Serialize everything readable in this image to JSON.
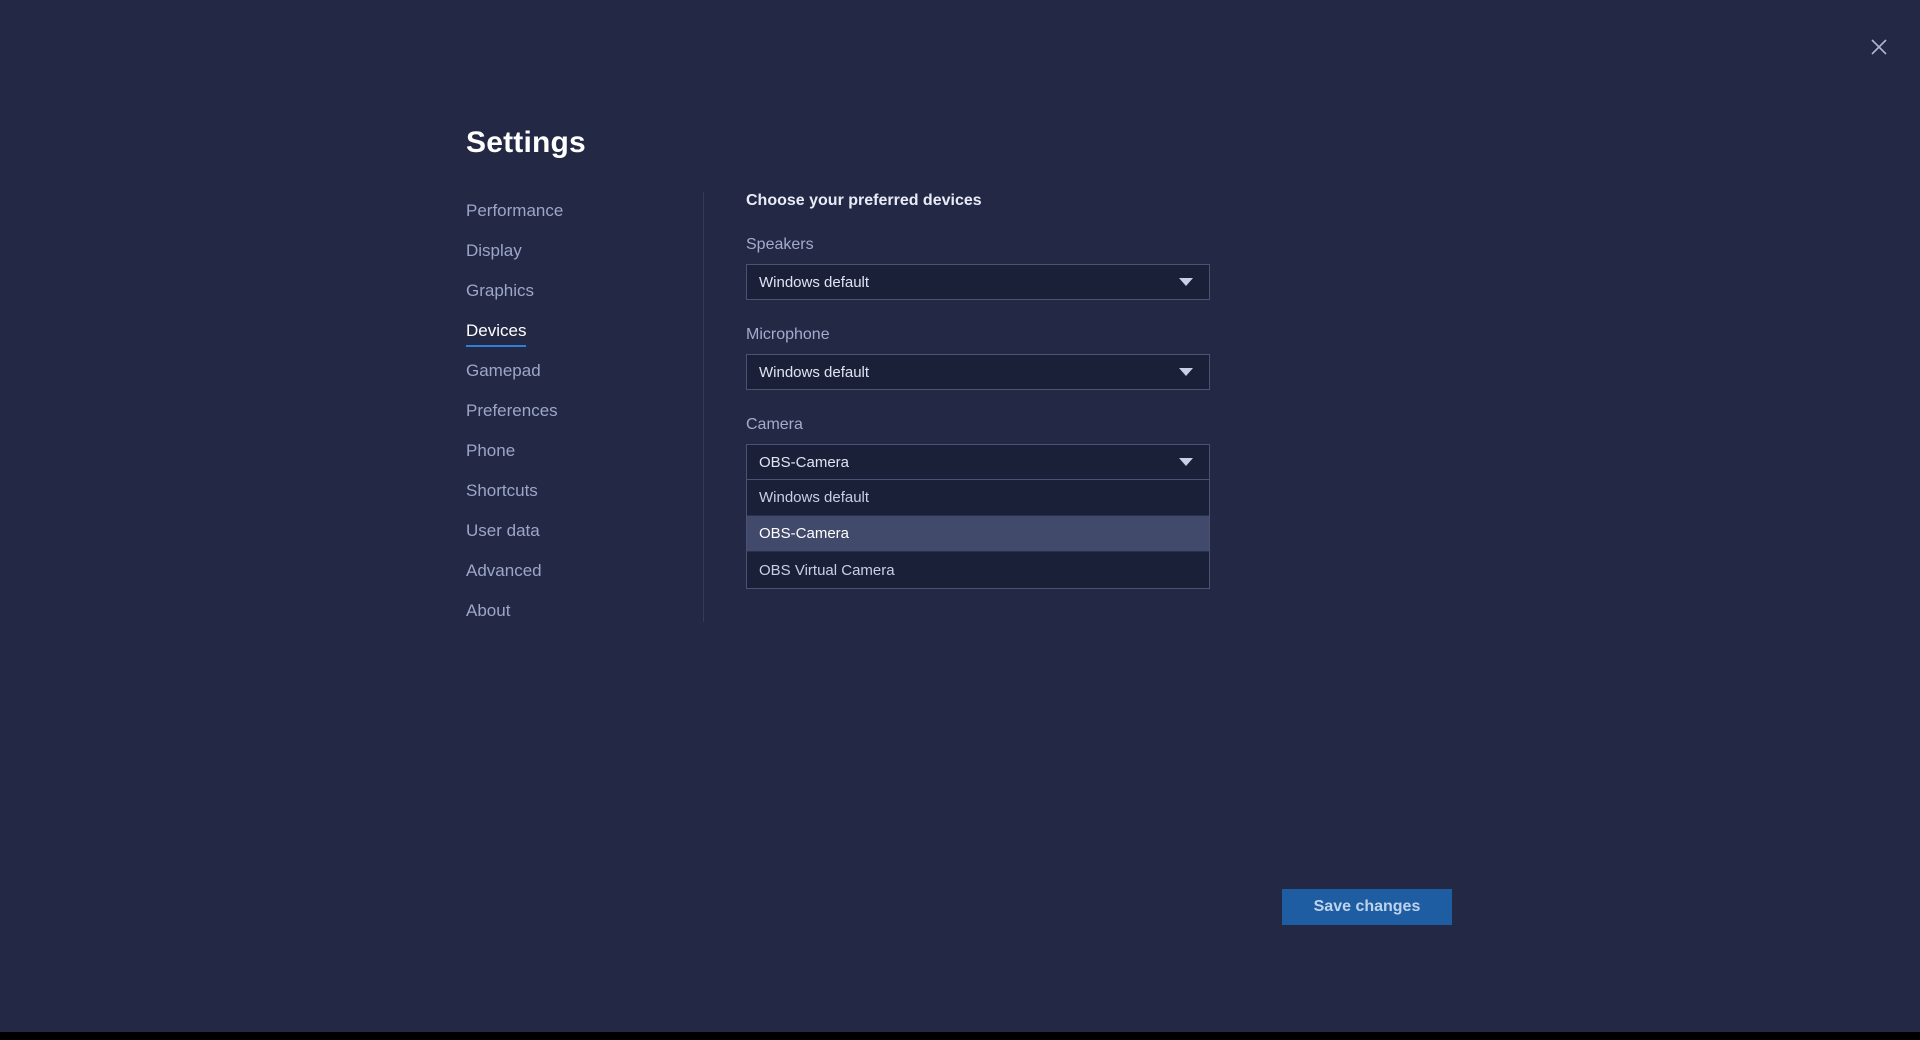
{
  "window": {
    "title": "Settings",
    "close_icon": "close-icon",
    "background_color": "#232845",
    "accent_color": "#2f7fd6"
  },
  "sidebar": {
    "items": [
      {
        "label": "Performance",
        "active": false
      },
      {
        "label": "Display",
        "active": false
      },
      {
        "label": "Graphics",
        "active": false
      },
      {
        "label": "Devices",
        "active": true
      },
      {
        "label": "Gamepad",
        "active": false
      },
      {
        "label": "Preferences",
        "active": false
      },
      {
        "label": "Phone",
        "active": false
      },
      {
        "label": "Shortcuts",
        "active": false
      },
      {
        "label": "User data",
        "active": false
      },
      {
        "label": "Advanced",
        "active": false
      },
      {
        "label": "About",
        "active": false
      }
    ]
  },
  "content": {
    "heading": "Choose your preferred devices",
    "fields": [
      {
        "label": "Speakers",
        "value": "Windows default",
        "arrow_icon": "chevron-down-icon",
        "open": false
      },
      {
        "label": "Microphone",
        "value": "Windows default",
        "arrow_icon": "chevron-down-icon",
        "open": false
      },
      {
        "label": "Camera",
        "value": "OBS-Camera",
        "arrow_icon": "chevron-down-icon",
        "open": true,
        "options": [
          {
            "label": "Windows default",
            "selected": false
          },
          {
            "label": "OBS-Camera",
            "selected": true
          },
          {
            "label": "OBS Virtual Camera",
            "selected": false
          }
        ]
      }
    ]
  },
  "footer": {
    "save_label": "Save changes"
  }
}
